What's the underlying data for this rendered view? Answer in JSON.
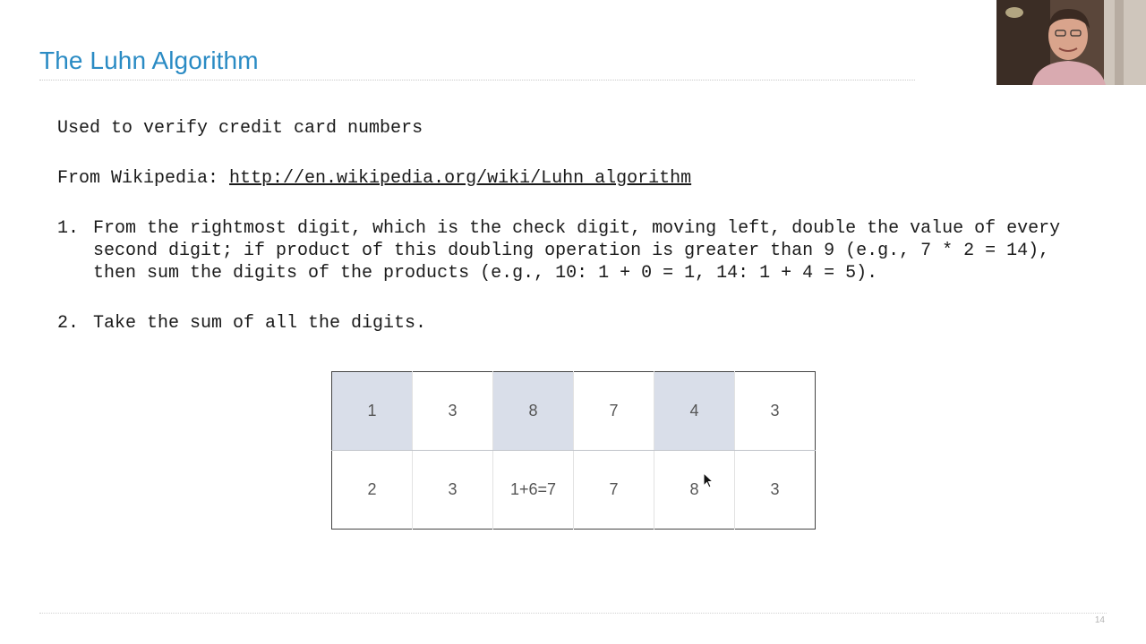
{
  "slide": {
    "title": "The Luhn Algorithm",
    "intro": "Used to verify credit card numbers",
    "wiki_label": "From Wikipedia: ",
    "wiki_link": "http://en.wikipedia.org/wiki/Luhn_algorithm",
    "steps": [
      {
        "number": "1.",
        "text": "From the rightmost digit, which is the check digit, moving left, double the value of every second digit; if product of this doubling operation is greater than 9 (e.g., 7 * 2 = 14), then sum the digits of the products (e.g., 10: 1 + 0 = 1, 14: 1 + 4 = 5)."
      },
      {
        "number": "2.",
        "text": "Take the sum of all the digits."
      }
    ],
    "table": {
      "top_row": [
        "1",
        "3",
        "8",
        "7",
        "4",
        "3"
      ],
      "bottom_row": [
        "2",
        "3",
        "1+6=7",
        "7",
        "8",
        "3"
      ],
      "highlight_color": "#d9dee9"
    },
    "page_number": "14"
  },
  "colors": {
    "title": "#2a8bc4",
    "text": "#1a1a1a",
    "table_text": "#555555",
    "highlight": "#d9dee9"
  },
  "icons": {
    "cursor": "mouse-pointer-icon"
  }
}
